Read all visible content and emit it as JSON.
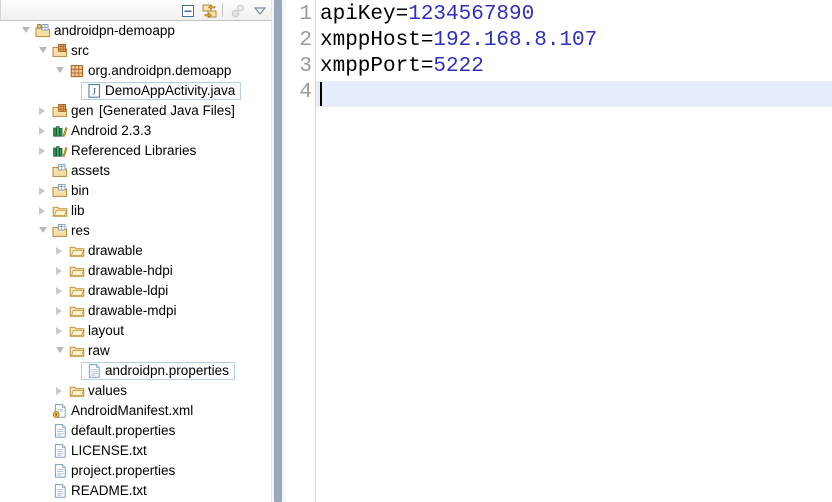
{
  "explorer": {
    "toolbar": {
      "buttons": [
        {
          "name": "collapse-all-icon",
          "label": "Collapse All"
        },
        {
          "name": "link-with-editor-icon",
          "label": "Link with Editor"
        },
        {
          "name": "focus-on-active-task-icon",
          "label": "Focus on Active Task"
        },
        {
          "name": "view-menu-chevron-down-icon",
          "label": "View Menu"
        }
      ]
    },
    "tree": [
      {
        "label": "androidpn-demoapp",
        "suffix": "",
        "depth": 0,
        "icon": "java-project-icon",
        "state": "expanded",
        "selected": false
      },
      {
        "label": "src",
        "suffix": "",
        "depth": 1,
        "icon": "source-folder-icon",
        "state": "expanded",
        "selected": false
      },
      {
        "label": "org.androidpn.demoapp",
        "suffix": "",
        "depth": 2,
        "icon": "package-icon",
        "state": "expanded",
        "selected": false
      },
      {
        "label": "DemoAppActivity.java",
        "suffix": "",
        "depth": 3,
        "icon": "java-file-icon",
        "state": "leaf",
        "selected": true
      },
      {
        "label": "gen",
        "suffix": " [Generated Java Files]",
        "depth": 1,
        "icon": "source-folder-icon",
        "state": "collapsed",
        "selected": false
      },
      {
        "label": "Android 2.3.3",
        "suffix": "",
        "depth": 1,
        "icon": "library-icon",
        "state": "collapsed",
        "selected": false
      },
      {
        "label": "Referenced Libraries",
        "suffix": "",
        "depth": 1,
        "icon": "library-icon",
        "state": "collapsed",
        "selected": false
      },
      {
        "label": "assets",
        "suffix": "",
        "depth": 1,
        "icon": "folder-res-icon",
        "state": "leaf",
        "selected": false
      },
      {
        "label": "bin",
        "suffix": "",
        "depth": 1,
        "icon": "folder-res-icon",
        "state": "collapsed",
        "selected": false
      },
      {
        "label": "lib",
        "suffix": "",
        "depth": 1,
        "icon": "folder-icon",
        "state": "collapsed",
        "selected": false
      },
      {
        "label": "res",
        "suffix": "",
        "depth": 1,
        "icon": "folder-res-icon",
        "state": "expanded",
        "selected": false
      },
      {
        "label": "drawable",
        "suffix": "",
        "depth": 2,
        "icon": "folder-icon",
        "state": "collapsed",
        "selected": false
      },
      {
        "label": "drawable-hdpi",
        "suffix": "",
        "depth": 2,
        "icon": "folder-icon",
        "state": "collapsed",
        "selected": false
      },
      {
        "label": "drawable-ldpi",
        "suffix": "",
        "depth": 2,
        "icon": "folder-icon",
        "state": "collapsed",
        "selected": false
      },
      {
        "label": "drawable-mdpi",
        "suffix": "",
        "depth": 2,
        "icon": "folder-icon",
        "state": "collapsed",
        "selected": false
      },
      {
        "label": "layout",
        "suffix": "",
        "depth": 2,
        "icon": "folder-icon",
        "state": "collapsed",
        "selected": false
      },
      {
        "label": "raw",
        "suffix": "",
        "depth": 2,
        "icon": "folder-icon",
        "state": "expanded",
        "selected": false
      },
      {
        "label": "androidpn.properties",
        "suffix": "",
        "depth": 3,
        "icon": "file-icon",
        "state": "leaf",
        "selected": true
      },
      {
        "label": "values",
        "suffix": "",
        "depth": 2,
        "icon": "folder-icon",
        "state": "collapsed",
        "selected": false
      },
      {
        "label": "AndroidManifest.xml",
        "suffix": "",
        "depth": 1,
        "icon": "android-manifest-icon",
        "state": "leaf",
        "selected": false
      },
      {
        "label": "default.properties",
        "suffix": "",
        "depth": 1,
        "icon": "file-icon",
        "state": "leaf",
        "selected": false
      },
      {
        "label": "LICENSE.txt",
        "suffix": "",
        "depth": 1,
        "icon": "file-icon",
        "state": "leaf",
        "selected": false
      },
      {
        "label": "project.properties",
        "suffix": "",
        "depth": 1,
        "icon": "file-icon",
        "state": "leaf",
        "selected": false
      },
      {
        "label": "README.txt",
        "suffix": "",
        "depth": 1,
        "icon": "file-icon",
        "state": "leaf",
        "selected": false
      }
    ]
  },
  "editor": {
    "lines": [
      {
        "number": "1",
        "key": "apiKey=",
        "value": "1234567890"
      },
      {
        "number": "2",
        "key": "xmppHost=",
        "value": "192.168.8.107"
      },
      {
        "number": "3",
        "key": "xmppPort=",
        "value": "5222"
      },
      {
        "number": "4",
        "key": "",
        "value": ""
      }
    ],
    "caret_line": 4,
    "colors": {
      "key": "#000000",
      "value": "#2f2fbf",
      "line_number": "#9b9b9b",
      "current_line_highlight": "#e7eefb"
    }
  }
}
